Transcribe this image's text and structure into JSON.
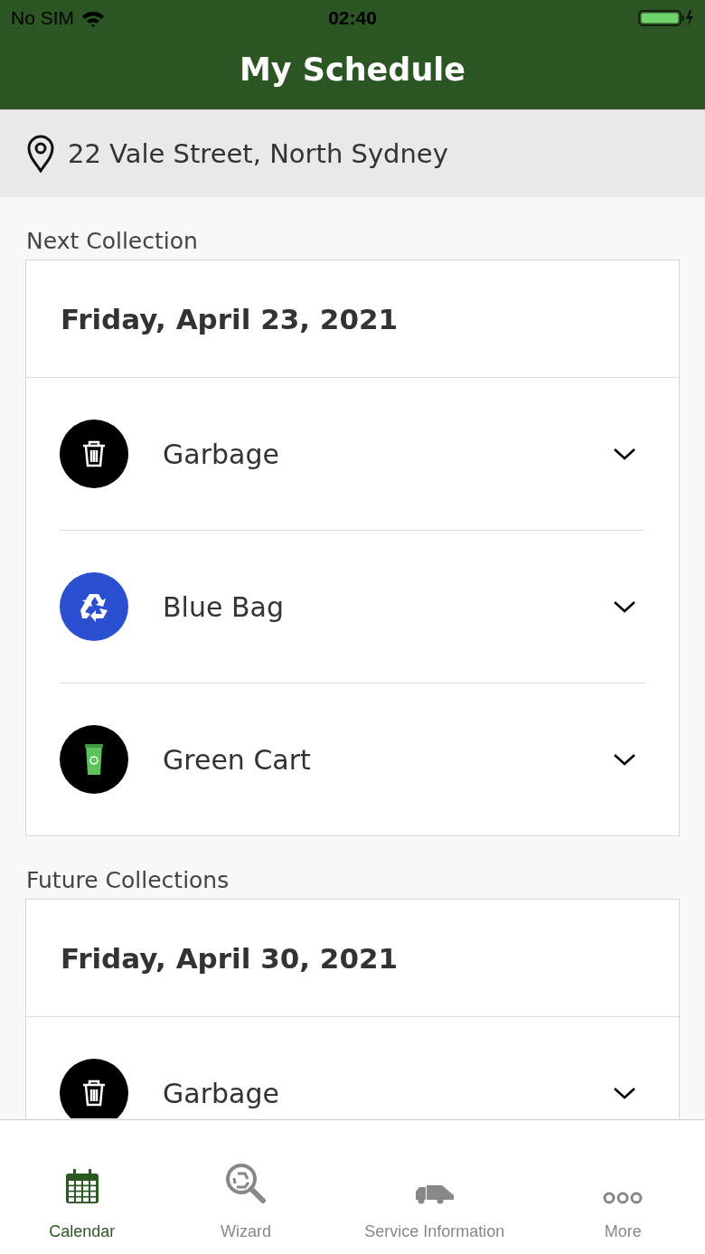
{
  "status_bar": {
    "carrier": "No SIM",
    "time": "02:40"
  },
  "header": {
    "title": "My Schedule"
  },
  "address": "22 Vale Street, North Sydney",
  "sections": [
    {
      "label": "Next Collection",
      "date": "Friday, April 23, 2021",
      "items": [
        {
          "name": "Garbage",
          "kind": "garbage"
        },
        {
          "name": "Blue Bag",
          "kind": "recycling"
        },
        {
          "name": "Green Cart",
          "kind": "cart"
        }
      ]
    },
    {
      "label": "Future Collections",
      "date": "Friday, April 30, 2021",
      "items": [
        {
          "name": "Garbage",
          "kind": "garbage"
        }
      ]
    }
  ],
  "tabs": [
    {
      "label": "Calendar",
      "kind": "calendar",
      "selected": true
    },
    {
      "label": "Wizard",
      "kind": "wizard",
      "selected": false
    },
    {
      "label": "Service Information",
      "kind": "truck",
      "selected": false
    },
    {
      "label": "More",
      "kind": "more",
      "selected": false
    }
  ]
}
